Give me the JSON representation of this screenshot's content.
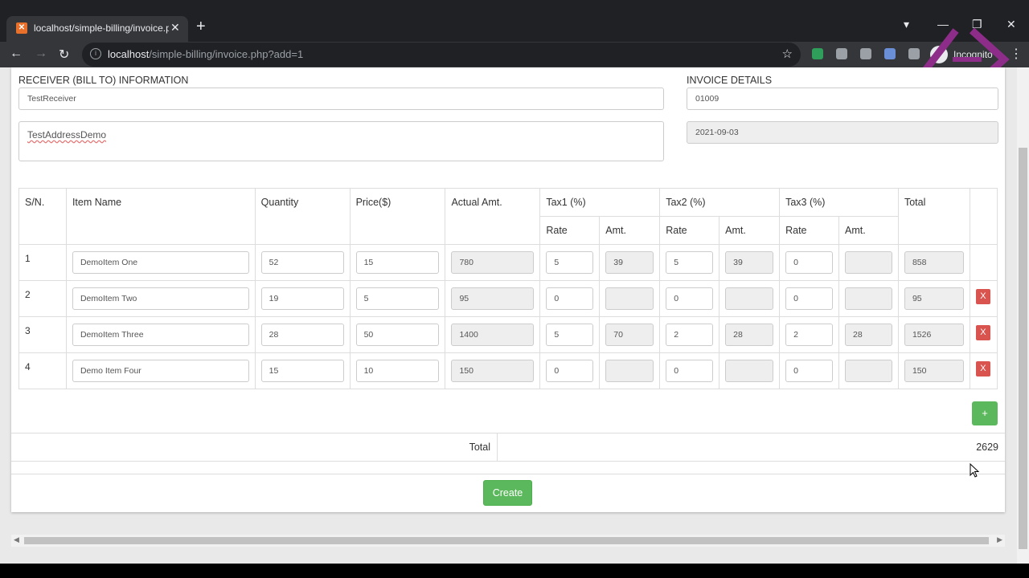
{
  "browser": {
    "tab_title": "localhost/simple-billing/invoice.p",
    "url_host": "localhost",
    "url_path": "/simple-billing/invoice.php?add=1",
    "profile_label": "Incognito"
  },
  "receiver": {
    "section_label": "RECEIVER (BILL TO) INFORMATION",
    "name_value": "TestReceiver",
    "address_value": "TestAddressDemo"
  },
  "invoice": {
    "section_label": "INVOICE DETAILS",
    "number_value": "01009",
    "date_value": "2021-09-03"
  },
  "table": {
    "headers": {
      "sn": "S/N.",
      "item_name": "Item Name",
      "quantity": "Quantity",
      "price": "Price($)",
      "actual_amt": "Actual Amt.",
      "tax1": "Tax1 (%)",
      "tax2": "Tax2 (%)",
      "tax3": "Tax3 (%)",
      "total": "Total",
      "rate": "Rate",
      "amt": "Amt."
    },
    "rows": [
      {
        "sn": "1",
        "item": "DemoItem One",
        "qty": "52",
        "price": "15",
        "actual": "780",
        "t1_rate": "5",
        "t1_amt": "39",
        "t2_rate": "5",
        "t2_amt": "39",
        "t3_rate": "0",
        "t3_amt": "",
        "total": "858"
      },
      {
        "sn": "2",
        "item": "DemoItem Two",
        "qty": "19",
        "price": "5",
        "actual": "95",
        "t1_rate": "0",
        "t1_amt": "",
        "t2_rate": "0",
        "t2_amt": "",
        "t3_rate": "0",
        "t3_amt": "",
        "total": "95",
        "delete": "X"
      },
      {
        "sn": "3",
        "item": "DemoItem Three",
        "qty": "28",
        "price": "50",
        "actual": "1400",
        "t1_rate": "5",
        "t1_amt": "70",
        "t2_rate": "2",
        "t2_amt": "28",
        "t3_rate": "2",
        "t3_amt": "28",
        "total": "1526",
        "delete": "X"
      },
      {
        "sn": "4",
        "item": "Demo Item Four",
        "qty": "15",
        "price": "10",
        "actual": "150",
        "t1_rate": "0",
        "t1_amt": "",
        "t2_rate": "0",
        "t2_amt": "",
        "t3_rate": "0",
        "t3_amt": "",
        "total": "150",
        "delete": "X"
      }
    ]
  },
  "add_button": "+",
  "summary": {
    "total_label": "Total",
    "total_value": "2629"
  },
  "create_button": "Create",
  "colors": {
    "success": "#5cb85c",
    "danger": "#d9534f"
  }
}
